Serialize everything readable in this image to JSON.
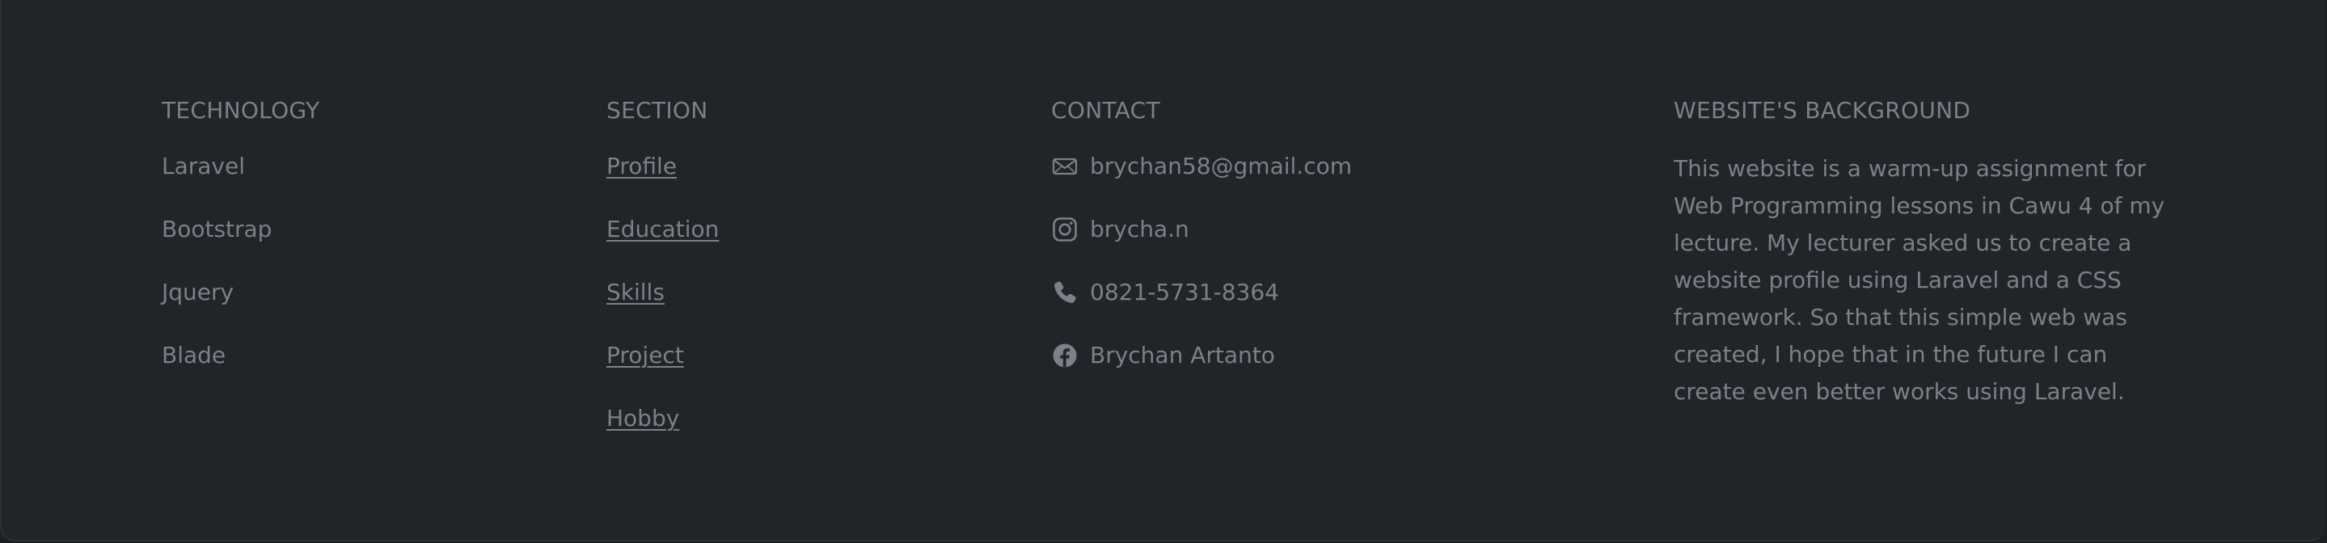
{
  "technology": {
    "heading": "TECHNOLOGY",
    "items": [
      "Laravel",
      "Bootstrap",
      "Jquery",
      "Blade"
    ]
  },
  "section": {
    "heading": "SECTION",
    "links": [
      "Profile",
      "Education",
      "Skills",
      "Project",
      "Hobby"
    ]
  },
  "contact": {
    "heading": "CONTACT",
    "email": {
      "icon": "envelope-icon",
      "text": "brychan58@gmail.com"
    },
    "instagram": {
      "icon": "instagram-icon",
      "text": "brycha.n"
    },
    "phone": {
      "icon": "phone-icon",
      "text": "0821-5731-8364"
    },
    "facebook": {
      "icon": "facebook-icon",
      "text": "Brychan Artanto"
    }
  },
  "background": {
    "heading": "WEBSITE'S BACKGROUND",
    "text": "This website is a warm-up assignment for Web Programming lessons in Cawu 4 of my lecture. My lecturer asked us to create a website profile using Laravel and a CSS framework. So that this simple web was created, I hope that in the future I can create even better works using Laravel."
  },
  "colors": {
    "background": "#212529",
    "text": "#7c8187"
  }
}
